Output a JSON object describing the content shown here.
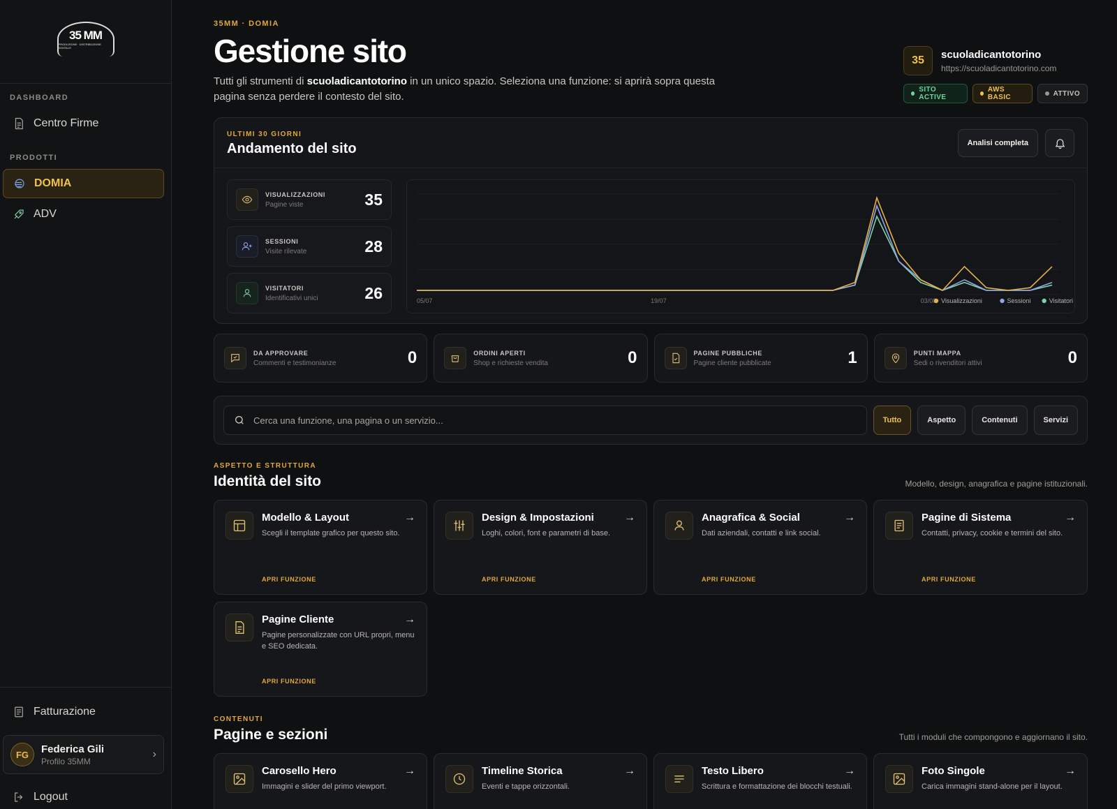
{
  "sidebar": {
    "logo_text": "35 MM",
    "logo_tag": "PRODUZIONE · DISTRIBUZIONE DIGITALE",
    "sections": {
      "dashboard": "DASHBOARD",
      "products": "PRODOTTI"
    },
    "items": {
      "centro_firme": "Centro Firme",
      "domia": "DOMIA",
      "adv": "ADV"
    },
    "billing": "Fatturazione",
    "user": {
      "initials": "FG",
      "name": "Federica Gili",
      "profile": "Profilo 35MM"
    },
    "logout": "Logout"
  },
  "header": {
    "eyebrow": "35MM · DOMIA",
    "title": "Gestione sito",
    "desc_pre": "Tutti gli strumenti di ",
    "desc_site": "scuoladicantotorino",
    "desc_post": " in un unico spazio. Seleziona una funzione: si aprirà sopra questa pagina senza perdere il contesto del sito."
  },
  "site": {
    "number": "35",
    "name": "scuoladicantotorino",
    "url": "https://scuoladicantotorino.com",
    "badges": [
      "SITO ACTIVE",
      "AWS BASIC",
      "ATTIVO"
    ]
  },
  "trend": {
    "eyebrow": "ULTIMI 30 GIORNI",
    "title": "Andamento del sito",
    "full_button": "Analisi completa",
    "stats": [
      {
        "label": "VISUALIZZAZIONI",
        "sub": "Pagine viste",
        "value": "35"
      },
      {
        "label": "SESSIONI",
        "sub": "Visite rilevate",
        "value": "28"
      },
      {
        "label": "VISITATORI",
        "sub": "Identificativi unici",
        "value": "26"
      }
    ]
  },
  "chart_data": {
    "type": "line",
    "x_ticks": [
      "05/07",
      "19/07",
      "03/08"
    ],
    "x_count": 30,
    "ylim": [
      0,
      38
    ],
    "series": [
      {
        "name": "Visualizzazioni",
        "color": "#e6b04a",
        "values": [
          0,
          0,
          0,
          0,
          0,
          0,
          0,
          0,
          0,
          0,
          0,
          0,
          0,
          0,
          0,
          0,
          0,
          0,
          0,
          0,
          3,
          35,
          14,
          4,
          0,
          9,
          1,
          0,
          1,
          9
        ]
      },
      {
        "name": "Sessioni",
        "color": "#8fa6e8",
        "values": [
          0,
          0,
          0,
          0,
          0,
          0,
          0,
          0,
          0,
          0,
          0,
          0,
          0,
          0,
          0,
          0,
          0,
          0,
          0,
          0,
          2,
          32,
          11,
          4,
          0,
          4,
          0,
          0,
          0,
          3
        ]
      },
      {
        "name": "Visitatori",
        "color": "#7fd0a8",
        "values": [
          0,
          0,
          0,
          0,
          0,
          0,
          0,
          0,
          0,
          0,
          0,
          0,
          0,
          0,
          0,
          0,
          0,
          0,
          0,
          0,
          2,
          28,
          11,
          3,
          0,
          3,
          0,
          0,
          0,
          2
        ]
      }
    ]
  },
  "kpis": [
    {
      "label": "DA APPROVARE",
      "sub": "Commenti e testimonianze",
      "value": "0"
    },
    {
      "label": "ORDINI APERTI",
      "sub": "Shop e richieste vendita",
      "value": "0"
    },
    {
      "label": "PAGINE PUBBLICHE",
      "sub": "Pagine cliente pubblicate",
      "value": "1"
    },
    {
      "label": "PUNTI MAPPA",
      "sub": "Sedi o rivenditori attivi",
      "value": "0"
    }
  ],
  "search": {
    "placeholder": "Cerca una funzione, una pagina o un servizio...",
    "filters": [
      "Tutto",
      "Aspetto",
      "Contenuti",
      "Servizi"
    ]
  },
  "identity": {
    "eyebrow": "ASPETTO E STRUTTURA",
    "title": "Identità del sito",
    "note": "Modello, design, anagrafica e pagine istituzionali.",
    "open_label": "APRI FUNZIONE",
    "cards": [
      {
        "title": "Modello & Layout",
        "desc": "Scegli il template grafico per questo sito."
      },
      {
        "title": "Design & Impostazioni",
        "desc": "Loghi, colori, font e parametri di base."
      },
      {
        "title": "Anagrafica & Social",
        "desc": "Dati aziendali, contatti e link social."
      },
      {
        "title": "Pagine di Sistema",
        "desc": "Contatti, privacy, cookie e termini del sito."
      },
      {
        "title": "Pagine Cliente",
        "desc": "Pagine personalizzate con URL propri, menu e SEO dedicata."
      }
    ]
  },
  "content": {
    "eyebrow": "CONTENUTI",
    "title": "Pagine e sezioni",
    "note": "Tutti i moduli che compongono e aggiornano il sito.",
    "cards": [
      {
        "title": "Carosello Hero",
        "desc": "Immagini e slider del primo viewport."
      },
      {
        "title": "Timeline Storica",
        "desc": "Eventi e tappe orizzontali."
      },
      {
        "title": "Testo Libero",
        "desc": "Scrittura e formattazione dei blocchi testuali."
      },
      {
        "title": "Foto Singole",
        "desc": "Carica immagini stand-alone per il layout."
      }
    ]
  }
}
